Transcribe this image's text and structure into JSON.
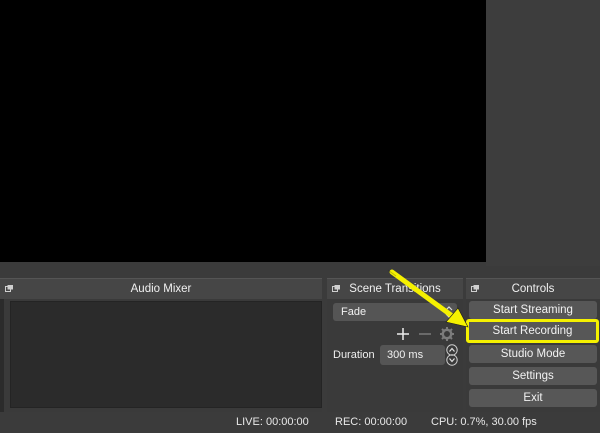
{
  "audio_mixer": {
    "title": "Audio Mixer"
  },
  "scene_transitions": {
    "title": "Scene Transitions",
    "transition_selected": "Fade",
    "add_icon": "plus-icon",
    "remove_icon": "minus-icon",
    "settings_icon": "gear-icon",
    "duration_label": "Duration",
    "duration_value": "300 ms"
  },
  "controls": {
    "title": "Controls",
    "start_streaming": "Start Streaming",
    "start_recording": "Start Recording",
    "studio_mode": "Studio Mode",
    "settings": "Settings",
    "exit": "Exit"
  },
  "status_bar": {
    "live": "LIVE: 00:00:00",
    "rec": "REC: 00:00:00",
    "cpu": "CPU: 0.7%, 30.00 fps"
  },
  "colors": {
    "highlight": "#f5f100",
    "preview_background": "#000000",
    "panel_background": "#3a3a3a"
  }
}
